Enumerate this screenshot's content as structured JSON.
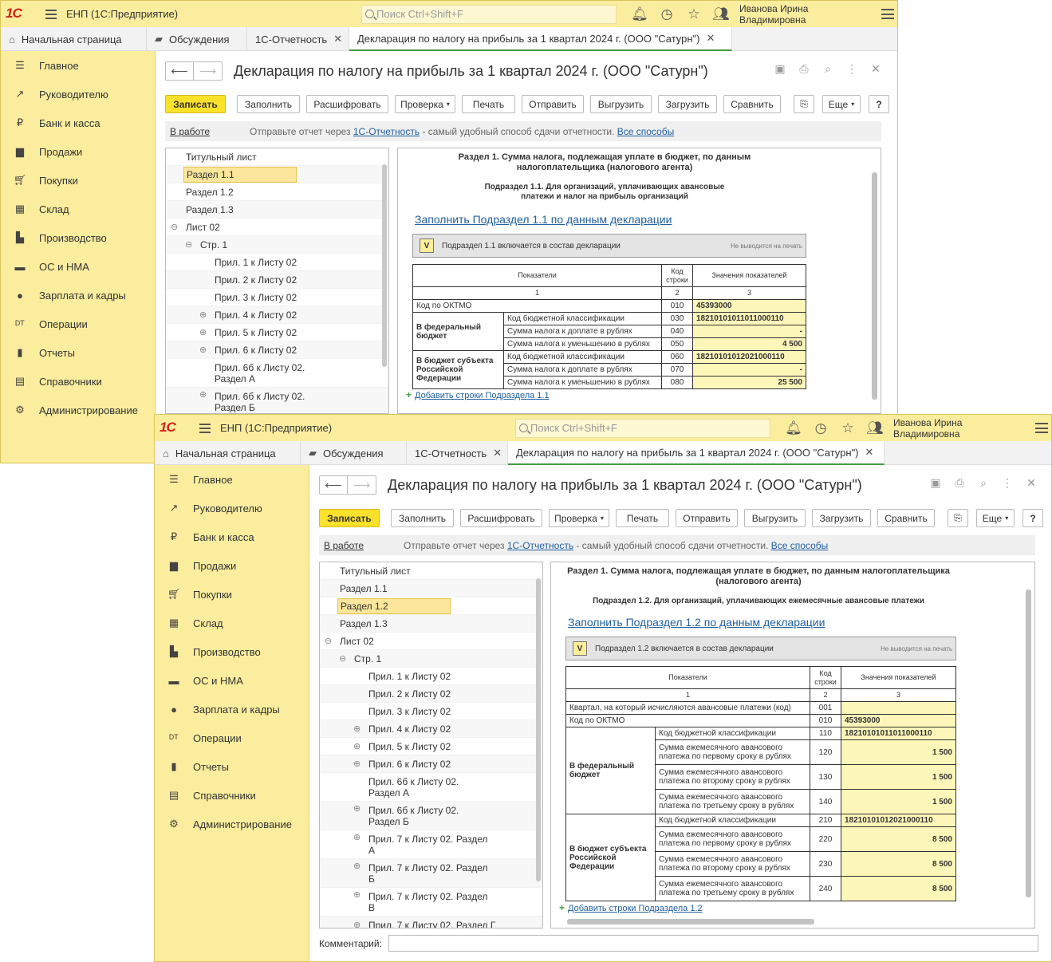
{
  "app": {
    "logo": "1С",
    "title": "ЕНП  (1С:Предприятие)",
    "search_placeholder": "Поиск Ctrl+Shift+F",
    "user": "Иванова Ирина Владимировна"
  },
  "tabs": [
    {
      "label": "Начальная страница",
      "icon": "home-icon"
    },
    {
      "label": "Обсуждения",
      "icon": "chat-icon"
    },
    {
      "label": "1С-Отчетность",
      "icon": ""
    },
    {
      "label": "Декларация по налогу на прибыль за 1 квартал 2024 г. (ООО \"Сатурн\")",
      "icon": ""
    }
  ],
  "sidebar": [
    {
      "label": "Главное",
      "icon": "menu-lines-icon"
    },
    {
      "label": "Руководителю",
      "icon": "trend-icon"
    },
    {
      "label": "Банк и касса",
      "icon": "ruble-coin-icon"
    },
    {
      "label": "Продажи",
      "icon": "bag-icon"
    },
    {
      "label": "Покупки",
      "icon": "cart-icon"
    },
    {
      "label": "Склад",
      "icon": "warehouse-icon"
    },
    {
      "label": "Производство",
      "icon": "factory-icon"
    },
    {
      "label": "ОС и НМА",
      "icon": "truck-icon"
    },
    {
      "label": "Зарплата и кадры",
      "icon": "person-icon"
    },
    {
      "label": "Операции",
      "icon": "dt-kt-icon"
    },
    {
      "label": "Отчеты",
      "icon": "bar-chart-icon"
    },
    {
      "label": "Справочники",
      "icon": "books-icon"
    },
    {
      "label": "Администрирование",
      "icon": "gear-icon"
    }
  ],
  "doc": {
    "title": "Декларация по налогу на прибыль за 1 квартал 2024 г. (ООО \"Сатурн\")",
    "buttons": {
      "save": "Записать",
      "fill": "Заполнить",
      "decode": "Расшифровать",
      "check": "Проверка",
      "print": "Печать",
      "send": "Отправить",
      "export": "Выгрузить",
      "import": "Загрузить",
      "compare": "Сравнить",
      "more": "Еще",
      "help": "?"
    },
    "status": "В работе",
    "info_prefix": "Отправьте отчет через ",
    "info_link": "1С-Отчетность",
    "info_suffix": " - самый удобный способ сдачи отчетности. ",
    "info_link2": "Все способы",
    "comment_label": "Комментарий:"
  },
  "tree": [
    "Титульный лист",
    "Раздел 1.1",
    "Раздел 1.2",
    "Раздел 1.3",
    "Лист 02",
    "Стр. 1",
    "Прил. 1 к Листу 02",
    "Прил. 2 к Листу 02",
    "Прил. 3 к Листу 02",
    "Прил. 4 к Листу 02",
    "Прил. 5 к Листу 02",
    "Прил. 6 к Листу 02",
    "Прил. 6б к Листу 02. Раздел А",
    "Прил. 6б к Листу 02. Раздел Б",
    "Прил. 7 к Листу 02. Раздел А",
    "Прил. 7 к Листу 02. Раздел Б",
    "Прил. 7 к Листу 02. Раздел В",
    "Прил. 7 к Листу 02. Раздел Г"
  ],
  "form1": {
    "title": "Раздел 1. Сумма налога, подлежащая уплате в бюджет, по данным налогоплательщика (налогового агента)",
    "subtitle": "Подраздел 1.1. Для организаций, уплачивающих авансовые платежи и налог на прибыль организаций",
    "fill_link": "Заполнить Подраздел 1.1 по данным декларации",
    "include_check": "V",
    "include_label": "Подраздел 1.1 включается в состав декларации",
    "no_print": "Не выводится на печать",
    "headers": [
      "Показатели",
      "Код строки",
      "Значения показателей"
    ],
    "header_nums": [
      "1",
      "2",
      "3"
    ],
    "oktmo_label": "Код по ОКТМО",
    "oktmo_code": "010",
    "oktmo_value": "45393000",
    "fed_group": "В федеральный бюджет",
    "fed_rows": [
      {
        "label": "Код бюджетной классификации",
        "code": "030",
        "value": "18210101011011000110"
      },
      {
        "label": "Сумма налога к доплате в рублях",
        "code": "040",
        "value": "-"
      },
      {
        "label": "Сумма налога к уменьшению в рублях",
        "code": "050",
        "value": "4 500"
      }
    ],
    "reg_group": "В бюджет субъекта Российской Федерации",
    "reg_rows": [
      {
        "label": "Код бюджетной классификации",
        "code": "060",
        "value": "18210101012021000110"
      },
      {
        "label": "Сумма налога к доплате в рублях",
        "code": "070",
        "value": "-"
      },
      {
        "label": "Сумма налога к уменьшению в рублях",
        "code": "080",
        "value": "25 500"
      }
    ],
    "add_rows": "Добавить строки Подраздела 1.1"
  },
  "form2": {
    "title": "Раздел 1. Сумма налога, подлежащая уплате в бюджет, по данным налогоплательщика (налогового агента)",
    "subtitle": "Подраздел 1.2. Для организаций, уплачивающих ежемесячные авансовые платежи",
    "fill_link": "Заполнить Подраздел 1.2 по данным декларации",
    "include_check": "V",
    "include_label": "Подраздел 1.2 включается в состав декларации",
    "no_print": "Не выводится на печать",
    "headers": [
      "Показатели",
      "Код строки",
      "Значения показателей"
    ],
    "header_nums": [
      "1",
      "2",
      "3"
    ],
    "quarter_label": "Квартал, на который исчисляются авансовые платежи (код)",
    "quarter_code": "001",
    "quarter_value": "",
    "oktmo_label": "Код по ОКТМО",
    "oktmo_code": "010",
    "oktmo_value": "45393000",
    "fed_group": "В федеральный бюджет",
    "fed_rows": [
      {
        "label": "Код бюджетной классификации",
        "code": "110",
        "value": "18210101011011000110"
      },
      {
        "label": "Сумма ежемесячного авансового платежа по первому сроку в рублях",
        "code": "120",
        "value": "1 500"
      },
      {
        "label": "Сумма ежемесячного авансового платежа по второму сроку в рублях",
        "code": "130",
        "value": "1 500"
      },
      {
        "label": "Сумма ежемесячного авансового платежа по третьему сроку в рублях",
        "code": "140",
        "value": "1 500"
      }
    ],
    "reg_group": "В бюджет субъекта Российской Федерации",
    "reg_rows": [
      {
        "label": "Код бюджетной классификации",
        "code": "210",
        "value": "18210101012021000110"
      },
      {
        "label": "Сумма ежемесячного авансового платежа по первому сроку в рублях",
        "code": "220",
        "value": "8 500"
      },
      {
        "label": "Сумма ежемесячного авансового платежа по второму сроку в рублях",
        "code": "230",
        "value": "8 500"
      },
      {
        "label": "Сумма ежемесячного авансового платежа по третьему сроку в рублях",
        "code": "240",
        "value": "8 500"
      }
    ],
    "add_rows": "Добавить строки Подраздела 1.2"
  }
}
